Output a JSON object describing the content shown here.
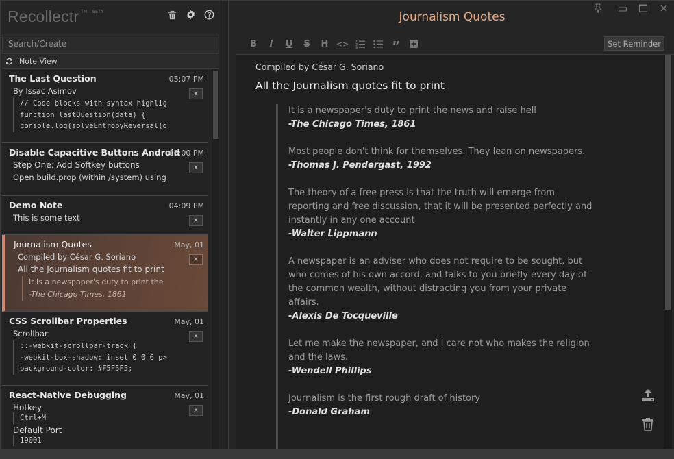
{
  "app": {
    "name": "Recollectr",
    "tag": "TM - BETA"
  },
  "search": {
    "placeholder": "Search/Create"
  },
  "view_mode": {
    "label": "Note View"
  },
  "notes": [
    {
      "title": "The Last Question",
      "time": "05:07 PM",
      "delete_label": "x",
      "line1": "By Issac Asimov",
      "code": [
        "// Code blocks with syntax highlig",
        "function lastQuestion(data) {",
        "console.log(solveEntropyReversal(d"
      ]
    },
    {
      "title": "Disable Capacitive Buttons Android",
      "time": "05:00 PM",
      "delete_label": "x",
      "line1": "Step One: Add Softkey buttons",
      "line2": "Open build.prop (within /system) using"
    },
    {
      "title": "Demo Note",
      "time": "04:09 PM",
      "delete_label": "x",
      "line1": "This is some text"
    },
    {
      "title": "Journalism Quotes",
      "time": "May, 01",
      "delete_label": "x",
      "line1": "Compiled by César G. Soriano",
      "line2": "All the Journalism quotes fit to print",
      "quote1": "It is a newspaper's duty to print the",
      "quote2": "-The Chicago Times, 1861"
    },
    {
      "title": "CSS Scrollbar Properties",
      "time": "May, 01",
      "delete_label": "x",
      "line1": "Scrollbar:",
      "code": [
        "::-webkit-scrollbar-track {",
        "-webkit-box-shadow: inset 0 0 6 p>",
        "background-color: #F5F5F5;"
      ]
    },
    {
      "title": "React-Native Debugging",
      "time": "May, 01",
      "delete_label": "x",
      "line1": "Hotkey",
      "code1": "Ctrl+M",
      "line2": "Default Port",
      "code2": "19001"
    }
  ],
  "editor": {
    "title": "Journalism Quotes",
    "reminder_label": "Set Reminder",
    "subtitle": "Compiled by César G. Soriano",
    "heading": "All the Journalism quotes fit to print",
    "quotes": [
      {
        "text": "It is a newspaper's duty to print the news and raise hell",
        "author": "-The Chicago Times, 1861"
      },
      {
        "text": "Most people don't think for themselves. They lean on newspapers.",
        "author": "-Thomas J. Pendergast, 1992"
      },
      {
        "text": "The theory of a free press is that the truth will emerge from reporting and free discussion, that it will be presented perfectly and instantly in any one account",
        "author": "-Walter Lippmann"
      },
      {
        "text": "A newspaper is an adviser who does not require to be sought, but who comes of his own accord, and talks to you briefly every day of the common wealth, without distracting you from your private affairs.",
        "author": "-Alexis De Tocqueville"
      },
      {
        "text": "Let me make the newspaper, and I care not who makes the religion and the laws.",
        "author": "-Wendell Phillips"
      },
      {
        "text": "Journalism is the first rough draft of history",
        "author": "-Donald Graham"
      }
    ]
  },
  "toolbar": {
    "bold": "B",
    "italic": "I",
    "underline": "U",
    "strike": "S",
    "heading": "H",
    "code": "<>",
    "quote": "”"
  },
  "colors": {
    "accent": "#e4a880",
    "selected_note": "#5a4136",
    "selected_border": "#d8866a"
  }
}
